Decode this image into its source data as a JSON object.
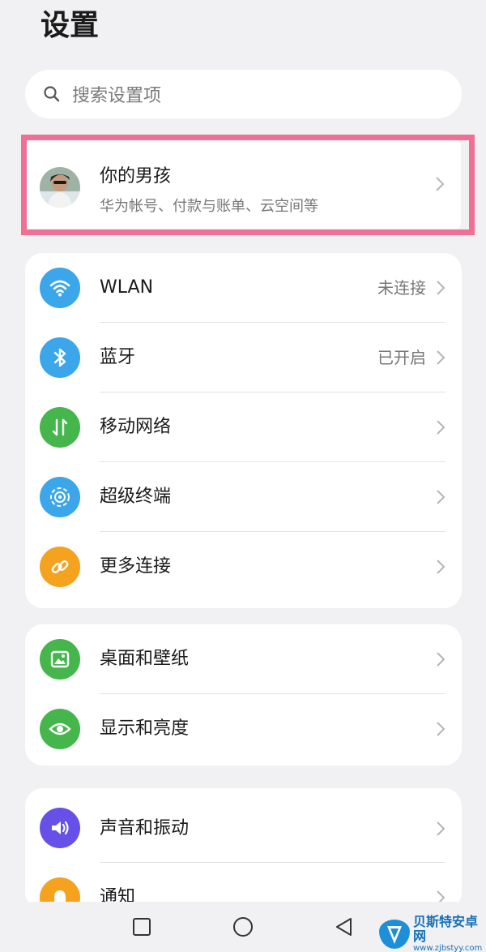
{
  "header": {
    "title": "设置"
  },
  "search": {
    "placeholder": "搜索设置项",
    "icon": "search-icon"
  },
  "account": {
    "name": "你的男孩",
    "subtitle": "华为帐号、付款与账单、云空间等",
    "highlight_color": "#ef6f95"
  },
  "groups": [
    {
      "items": [
        {
          "label": "WLAN",
          "value": "未连接",
          "icon": "wifi-icon",
          "color": "#3ba6ea"
        },
        {
          "label": "蓝牙",
          "value": "已开启",
          "icon": "bluetooth-icon",
          "color": "#3ba6ea"
        },
        {
          "label": "移动网络",
          "value": "",
          "icon": "mobile-data-icon",
          "color": "#45b64c"
        },
        {
          "label": "超级终端",
          "value": "",
          "icon": "super-device-icon",
          "color": "#3ba6ea"
        },
        {
          "label": "更多连接",
          "value": "",
          "icon": "link-icon",
          "color": "#f5a21f"
        }
      ]
    },
    {
      "items": [
        {
          "label": "桌面和壁纸",
          "value": "",
          "icon": "wallpaper-icon",
          "color": "#45b64c"
        },
        {
          "label": "显示和亮度",
          "value": "",
          "icon": "eye-icon",
          "color": "#45b64c"
        }
      ]
    },
    {
      "items": [
        {
          "label": "声音和振动",
          "value": "",
          "icon": "speaker-icon",
          "color": "#6750e8"
        },
        {
          "label": "通知",
          "value": "",
          "icon": "bell-icon",
          "color": "#f5a21f"
        }
      ]
    }
  ],
  "navbar": {
    "items": [
      "recents-icon",
      "home-icon",
      "back-icon"
    ]
  },
  "watermark": {
    "title": "贝斯特安卓网",
    "url": "www.zjbstyy.com"
  }
}
